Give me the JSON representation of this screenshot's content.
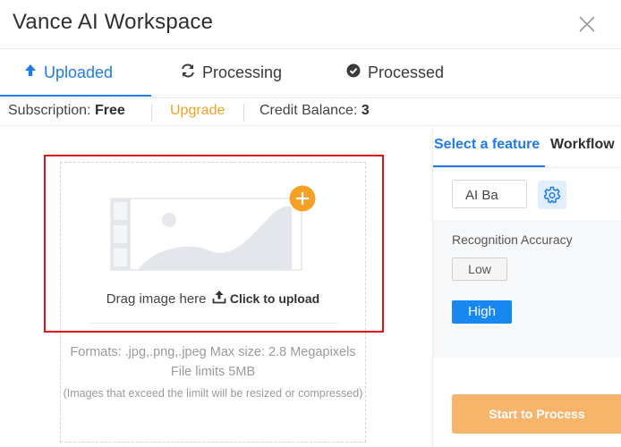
{
  "window": {
    "title": "Vance AI Workspace"
  },
  "tabs": [
    {
      "label": "Uploaded",
      "icon": "upload-arrow-icon",
      "active": true
    },
    {
      "label": "Processing",
      "icon": "sync-icon",
      "active": false
    },
    {
      "label": "Processed",
      "icon": "check-circle-icon",
      "active": false
    }
  ],
  "subscription": {
    "label": "Subscription:",
    "plan": "Free",
    "upgrade": "Upgrade",
    "credit_label": "Credit Balance:",
    "credit_value": "3"
  },
  "dropzone": {
    "drag_text": "Drag image here",
    "click_text": "Click to upload",
    "formats": "Formats: .jpg,.png,.jpeg Max size: 2.8 Megapixels File limits 5MB",
    "note": "(Images that exceed the limilt will be resized or compressed)"
  },
  "right_panel": {
    "tabs": [
      {
        "label": "Select a feature",
        "active": true
      },
      {
        "label": "Workflow",
        "active": false
      }
    ],
    "feature_select": "AI Ba",
    "recognition_label": "Recognition Accuracy",
    "low_label": "Low",
    "high_label": "High",
    "start_button": "Start to Process"
  },
  "colors": {
    "accent": "#1e7be8",
    "upgrade": "#f0a225",
    "highlight_border": "#e0131a",
    "start_button": "#f8b46a",
    "plus_badge": "#f7a028"
  }
}
